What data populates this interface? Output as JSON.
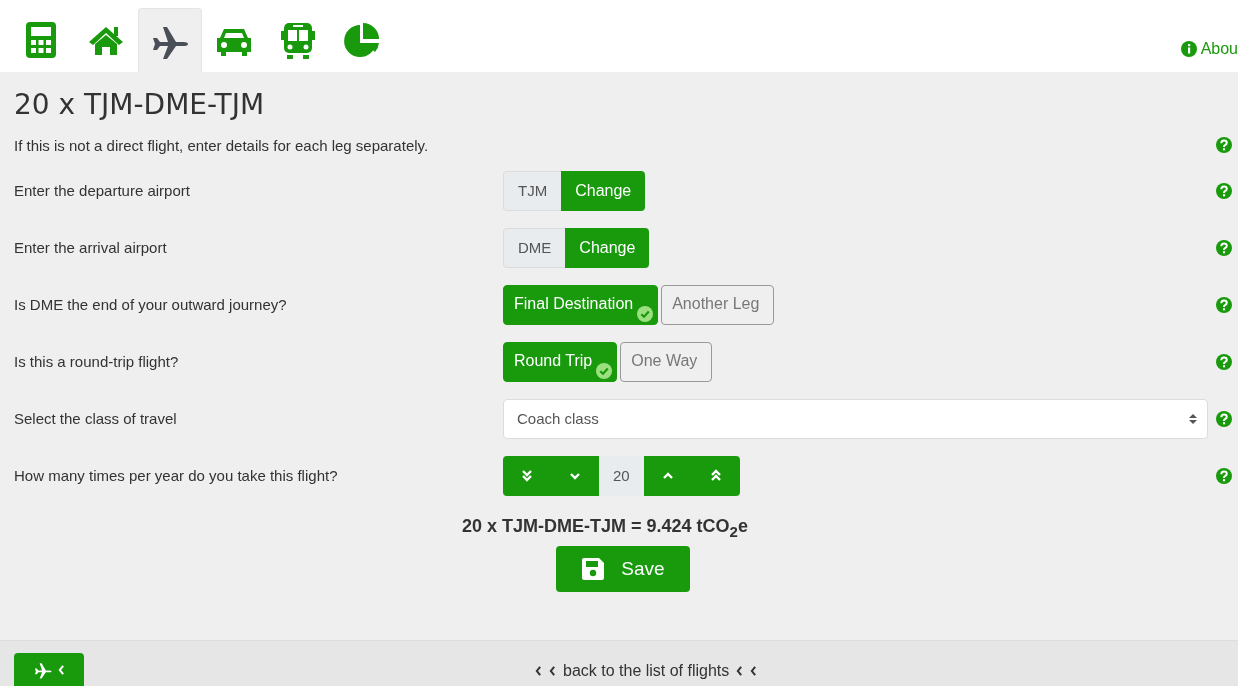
{
  "tabs": [
    {
      "kind": "calculator",
      "selected": false
    },
    {
      "kind": "house",
      "selected": false
    },
    {
      "kind": "plane",
      "selected": true
    },
    {
      "kind": "car",
      "selected": false
    },
    {
      "kind": "bus",
      "selected": false
    },
    {
      "kind": "pie",
      "selected": false
    }
  ],
  "about": "Abou",
  "title": "20 x TJM-DME-TJM",
  "intro": "If this is not a direct flight, enter details for each leg separately.",
  "rows": [
    {
      "kind": "airport",
      "label": "Enter the departure airport",
      "value": "TJM",
      "button": "Change"
    },
    {
      "kind": "airport",
      "label": "Enter the arrival airport",
      "value": "DME",
      "button": "Change"
    },
    {
      "kind": "choice",
      "label": "Is DME the end of your outward journey?",
      "options": [
        {
          "label": "Final Destination",
          "selected": true
        },
        {
          "label": "Another Leg",
          "selected": false
        }
      ]
    },
    {
      "kind": "choice",
      "label": "Is this a round-trip flight?",
      "options": [
        {
          "label": "Round Trip",
          "selected": true
        },
        {
          "label": "One Way",
          "selected": false
        }
      ]
    },
    {
      "kind": "select",
      "label": "Select the class of travel",
      "value": "Coach class"
    },
    {
      "kind": "stepper",
      "label": "How many times per year do you take this flight?",
      "value": "20"
    }
  ],
  "result": "20 x TJM-DME-TJM = 9.424 tCO$_{2}$e",
  "save": "Save",
  "footer": {
    "back": "back to the list of flights"
  }
}
